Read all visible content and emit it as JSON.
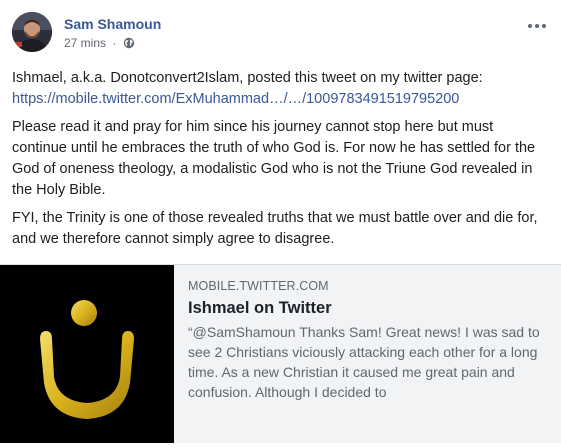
{
  "post": {
    "author": "Sam Shamoun",
    "time": "27 mins",
    "separator": "·",
    "privacy_icon": "globe-icon",
    "menu_icon": "more-options-icon",
    "paragraphs": [
      {
        "text": "Ishmael, a.k.a. Donotconvert2Islam, posted this tweet on my twitter page:",
        "link": "https://mobile.twitter.com/ExMuhammad…/…/1009783491519795200"
      },
      {
        "text": "Please read it and pray for him since his journey cannot stop here but must continue until he embraces the truth of who God is. For now he has settled for the God of oneness theology, a modalistic God who is not the Triune God revealed in the Holy Bible."
      },
      {
        "text": "FYI, the Trinity is one of those revealed truths that we must battle over and die for, and we therefore cannot simply agree to disagree."
      }
    ]
  },
  "link_card": {
    "domain": "MOBILE.TWITTER.COM",
    "title": "Ishmael on Twitter",
    "description": "“@SamShamoun Thanks Sam! Great news! I was sad to see 2 Christians viciously attacking each other for a long time. As a new Christian it caused me great pain and confusion. Although I decided to",
    "thumbnail_icon": "arabic-nun-symbol-icon"
  },
  "colors": {
    "link": "#385898",
    "card_bg": "#f2f3f5",
    "symbol_gold": "#d9b21c"
  }
}
